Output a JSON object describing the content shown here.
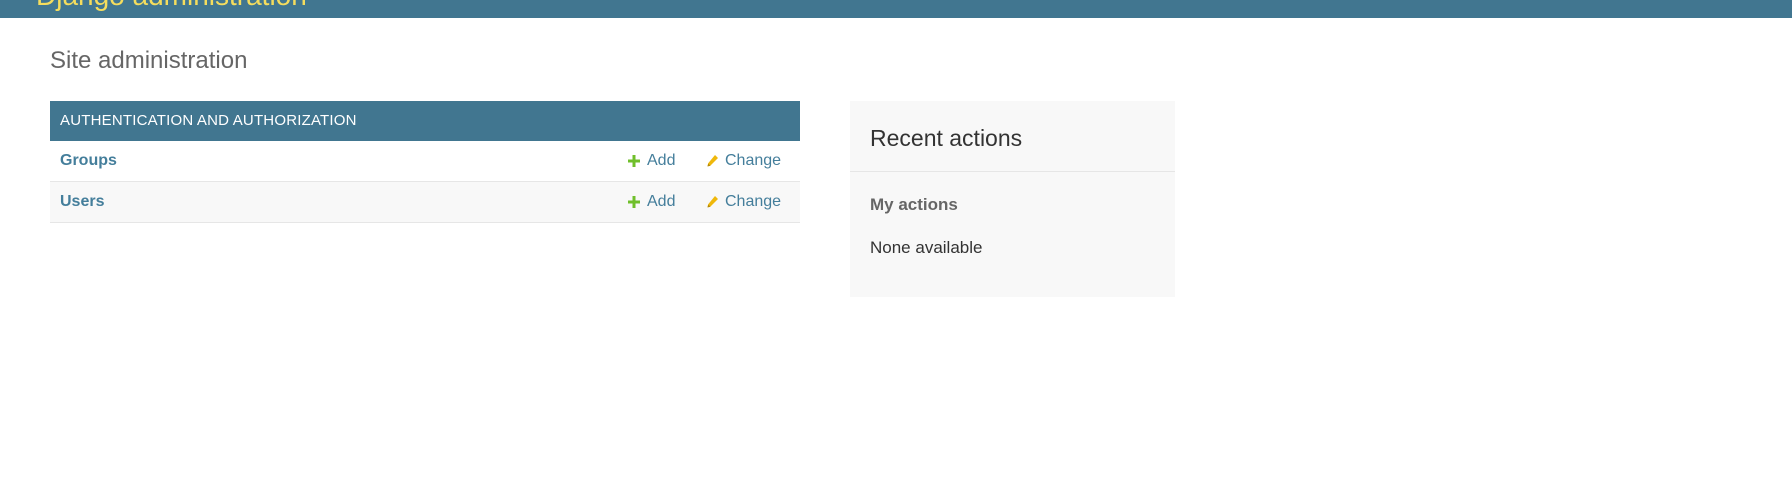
{
  "header": {
    "brand": "Django administration"
  },
  "page": {
    "title": "Site administration"
  },
  "app_module": {
    "caption": "AUTHENTICATION AND AUTHORIZATION",
    "models": [
      {
        "name": "Groups",
        "add_label": "Add",
        "change_label": "Change"
      },
      {
        "name": "Users",
        "add_label": "Add",
        "change_label": "Change"
      }
    ]
  },
  "recent_actions": {
    "title": "Recent actions",
    "subtitle": "My actions",
    "empty_text": "None available"
  },
  "colors": {
    "header_bg": "#417690",
    "brand": "#f5dd5d",
    "link": "#447e9b",
    "add_icon": "#70bf2b",
    "change_icon": "#efb80b"
  },
  "icons": {
    "add": "plus-icon",
    "change": "pencil-icon"
  }
}
